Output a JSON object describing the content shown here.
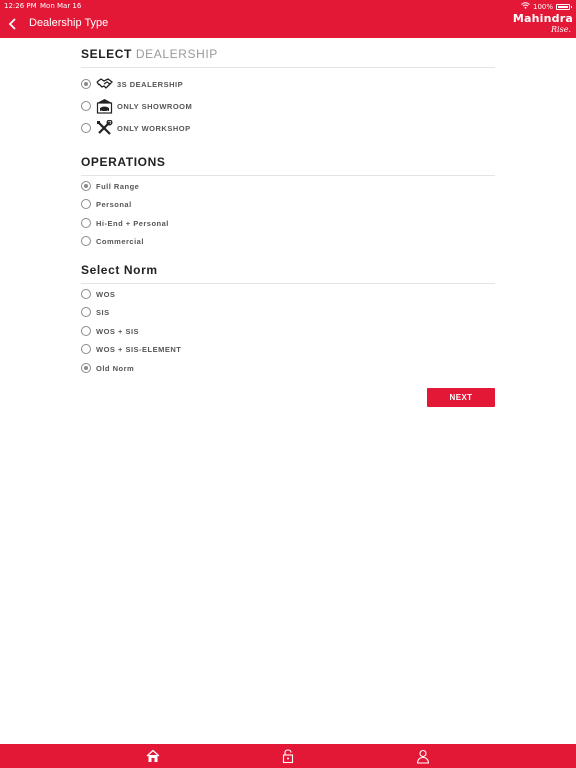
{
  "status_bar": {
    "time": "12:26 PM",
    "date": "Mon Mar 16",
    "battery": "100%"
  },
  "header": {
    "title": "Dealership Type",
    "logo_main": "Mahindra",
    "logo_sub": "Rise."
  },
  "select_dealership": {
    "title_bold": "SELECT",
    "title_light": "DEALERSHIP",
    "options": [
      {
        "label": "3S DEALERSHIP",
        "icon": "handshake-icon",
        "checked": true
      },
      {
        "label": "ONLY SHOWROOM",
        "icon": "showroom-icon",
        "checked": false
      },
      {
        "label": "ONLY WORKSHOP",
        "icon": "tools-icon",
        "checked": false
      }
    ]
  },
  "operations": {
    "title": "OPERATIONS",
    "options": [
      {
        "label": "Full Range",
        "checked": true
      },
      {
        "label": "Personal",
        "checked": false
      },
      {
        "label": "Hi-End + Personal",
        "checked": false
      },
      {
        "label": "Commercial",
        "checked": false
      }
    ]
  },
  "select_norm": {
    "title": "Select Norm",
    "options": [
      {
        "label": "WOS",
        "checked": false
      },
      {
        "label": "SIS",
        "checked": false
      },
      {
        "label": "WOS + SIS",
        "checked": false
      },
      {
        "label": "WOS + SIS-ELEMENT",
        "checked": false
      },
      {
        "label": "Old Norm",
        "checked": true
      }
    ]
  },
  "next_label": "NEXT",
  "tabbar": {
    "icons": [
      "home-icon",
      "lock-icon",
      "profile-icon"
    ]
  },
  "colors": {
    "brand_red": "#e31837",
    "radio_gray": "#8a8a8a"
  }
}
